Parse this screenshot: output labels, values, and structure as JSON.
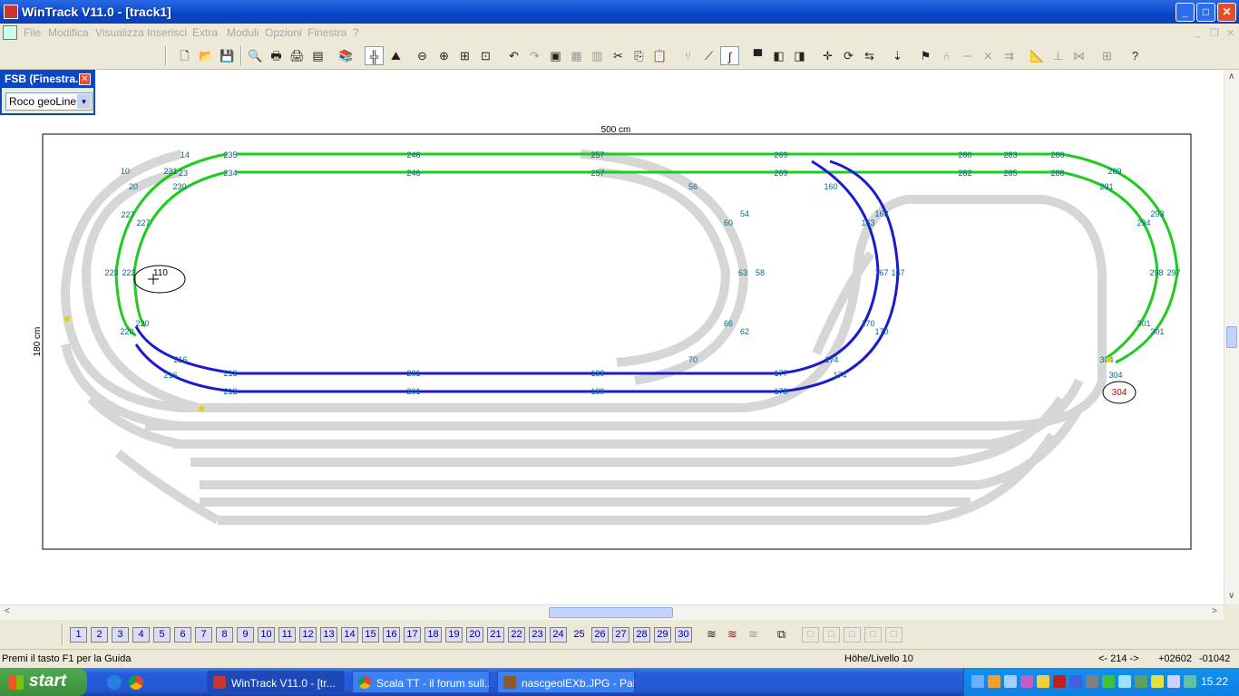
{
  "window": {
    "title": "WinTrack  V11.0 - [track1]",
    "min": "_",
    "max": "□",
    "close": "✕"
  },
  "menu": {
    "items": [
      "File",
      "Modifica",
      "Visualizza",
      "Inserisci",
      "Extra",
      "Moduli",
      "Opzioni",
      "Finestra",
      "?"
    ]
  },
  "fsb": {
    "title": "FSB (Finestra...",
    "close": "✕",
    "selected": "Roco geoLine H",
    "arrow": "▾"
  },
  "drawing": {
    "width_label": "500 cm",
    "height_label": "180 cm",
    "colors": {
      "green": "#1ecb1e",
      "blue": "#1a1ad0",
      "grey": "#d8d8d8",
      "label": "#006b8f"
    },
    "numbers_top": [
      "14",
      "235",
      "246",
      "257",
      "269",
      "280",
      "283",
      "286"
    ],
    "numbers_top2": [
      "23",
      "234",
      "246",
      "257",
      "269",
      "282",
      "285",
      "288"
    ],
    "numbers_left": [
      "10",
      "20",
      "230",
      "231",
      "227",
      "227",
      "223",
      "222",
      "220",
      "220",
      "216",
      "216",
      "213",
      "212"
    ],
    "numbers_mid": [
      "56",
      "60",
      "54",
      "63",
      "58",
      "66",
      "62",
      "70",
      "160",
      "163",
      "163",
      "167",
      "167",
      "170",
      "170",
      "174",
      "174",
      "177",
      "178"
    ],
    "numbers_right": [
      "289",
      "291",
      "293",
      "294",
      "298",
      "297",
      "301",
      "301",
      "304",
      "304"
    ],
    "numbers_bottom": [
      "201",
      "201",
      "189",
      "189"
    ],
    "marker_left": "110",
    "marker_right": "304"
  },
  "layers": {
    "buttons": [
      "1",
      "2",
      "3",
      "4",
      "5",
      "6",
      "7",
      "8",
      "9",
      "10",
      "11",
      "12",
      "13",
      "14",
      "15",
      "16",
      "17",
      "18",
      "19",
      "20",
      "21",
      "22",
      "23",
      "24",
      "25",
      "26",
      "27",
      "28",
      "29",
      "30"
    ]
  },
  "status": {
    "help": "Premi il tasto F1 per la Guida",
    "level": "Höhe/Livello 10",
    "angle": "<- 214 ->",
    "x": "+02602",
    "y": "-01042"
  },
  "taskbar": {
    "start": "start",
    "tasks": [
      "WinTrack  V11.0 - [tr...",
      "Scala TT - il forum sull...",
      "nascgeolEXb.JPG - Paint"
    ],
    "clock": "15.22"
  }
}
